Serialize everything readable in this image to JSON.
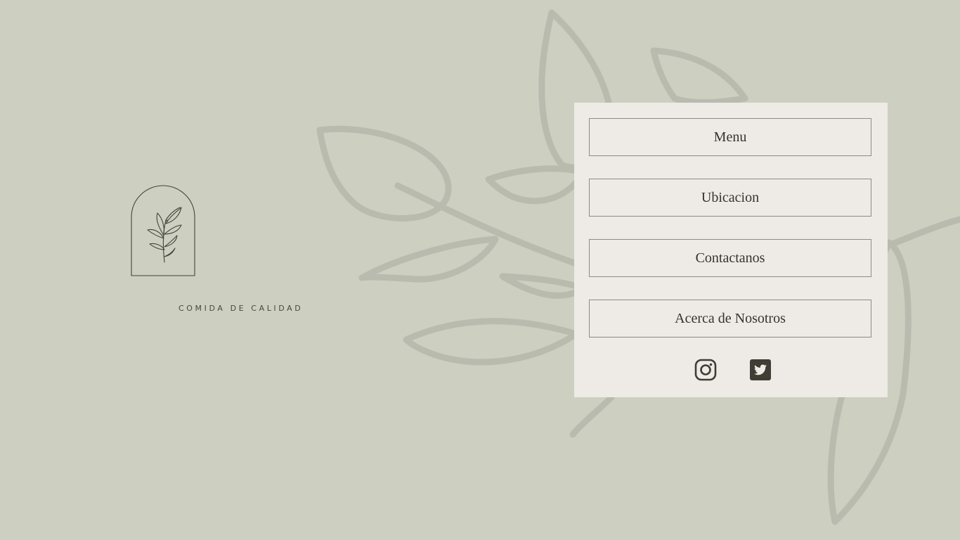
{
  "brand": {
    "tagline": "COMIDA DE CALIDAD",
    "logo_icon": "leaf-branch-arch-icon"
  },
  "nav": {
    "items": [
      {
        "label": "Menu"
      },
      {
        "label": "Ubicacion"
      },
      {
        "label": "Contactanos"
      },
      {
        "label": "Acerca de Nosotros"
      }
    ]
  },
  "social": {
    "instagram_icon": "instagram-icon",
    "twitter_icon": "twitter-icon"
  },
  "colors": {
    "background": "#cdcfc1",
    "panel": "#eeeae5",
    "text": "#35342d",
    "leaf_outline": "#b8bbad"
  }
}
